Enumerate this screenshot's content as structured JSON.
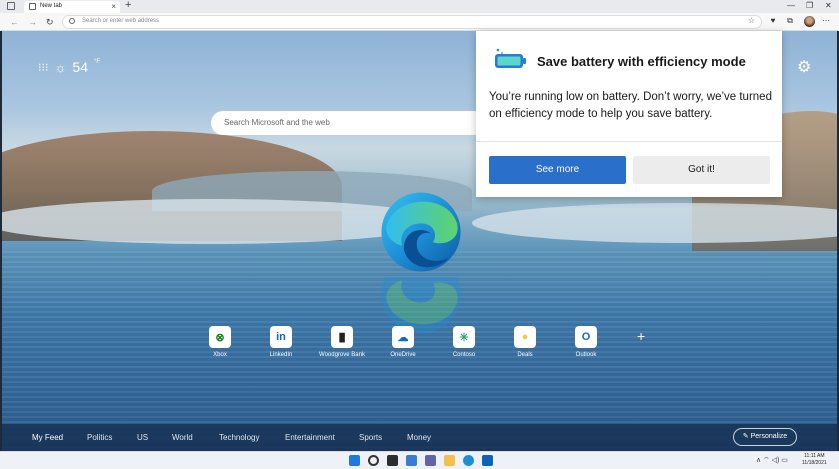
{
  "browser": {
    "tab_title": "New tab",
    "tab_close": "×",
    "new_tab": "+",
    "address_placeholder": "Search or enter web address",
    "window_min": "—",
    "window_max": "❐",
    "window_close": "✕"
  },
  "ntp": {
    "apps_icon": "⁝⁝⁝",
    "sun_icon": "☼",
    "temperature": "54",
    "temperature_unit": "°F",
    "settings_icon": "⚙",
    "search_placeholder": "Search Microsoft and the web",
    "tiles": [
      {
        "label": "Xbox",
        "glyph": "⊗",
        "color": "#107c10"
      },
      {
        "label": "LinkedIn",
        "glyph": "in",
        "color": "#0a66c2"
      },
      {
        "label": "Woodgrove Bank",
        "glyph": "▐▌",
        "color": "#222222"
      },
      {
        "label": "OneDrive",
        "glyph": "☁",
        "color": "#0f6cbd"
      },
      {
        "label": "Contoso",
        "glyph": "✳",
        "color": "#2aa37a"
      },
      {
        "label": "Deals",
        "glyph": "●",
        "color": "#f2c94c"
      },
      {
        "label": "Outlook",
        "glyph": "O",
        "color": "#0f6cbd"
      }
    ],
    "add_tile": "+",
    "feed": [
      "My Feed",
      "Politics",
      "US",
      "World",
      "Technology",
      "Entertainment",
      "Sports",
      "Money"
    ],
    "personalize": "✎ Personalize"
  },
  "popup": {
    "title": "Save battery with efficiency mode",
    "body": "You’re running low on battery. Don’t worry, we’ve turned on efficiency mode to help you save battery.",
    "primary": "See more",
    "secondary": "Got it!"
  },
  "taskbar": {
    "tray": "∧ ⌔ ◁) ▭",
    "time": "11:11 AM",
    "date": "11/18/2021"
  }
}
